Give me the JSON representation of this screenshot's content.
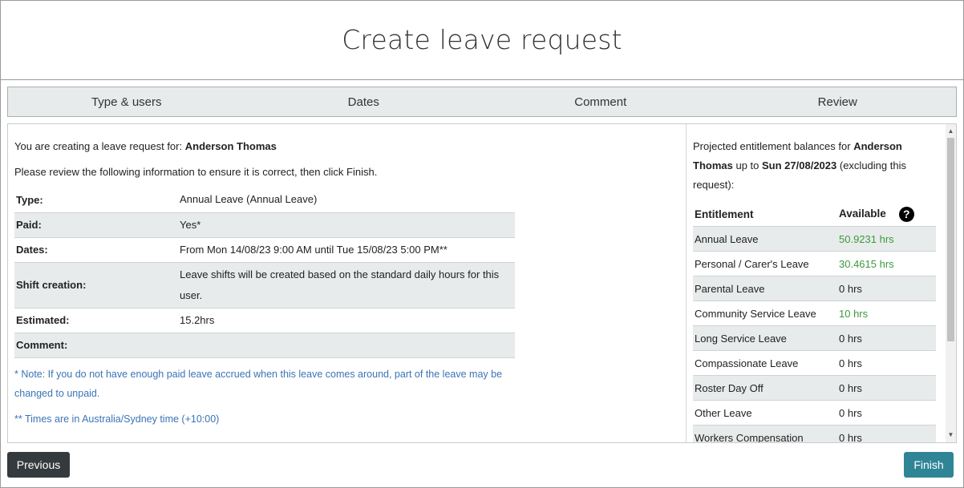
{
  "page": {
    "title": "Create leave request"
  },
  "steps": [
    "Type & users",
    "Dates",
    "Comment",
    "Review"
  ],
  "summary": {
    "intro_prefix": "You are creating a leave request for:",
    "user_name": "Anderson Thomas",
    "instruction": "Please review the following information to ensure it is correct, then click Finish.",
    "rows": [
      {
        "label": "Type:",
        "value": "Annual Leave (Annual Leave)"
      },
      {
        "label": "Paid:",
        "value": "Yes*"
      },
      {
        "label": "Dates:",
        "value": "From Mon 14/08/23 9:00 AM until Tue 15/08/23 5:00 PM**"
      },
      {
        "label": "Shift creation:",
        "value": "Leave shifts will be created based on the standard daily hours for this user."
      },
      {
        "label": "Estimated:",
        "value": "15.2hrs"
      },
      {
        "label": "Comment:",
        "value": ""
      }
    ],
    "note1": "* Note: If you do not have enough paid leave accrued when this leave comes around, part of the leave may be changed to unpaid.",
    "note2": "** Times are in Australia/Sydney time (+10:00)"
  },
  "entitlements": {
    "intro_prefix": "Projected entitlement balances for",
    "user_name": "Anderson Thomas",
    "up_to_text": "up to",
    "date": "Sun 27/08/2023",
    "suffix": "(excluding this request):",
    "header_entitlement": "Entitlement",
    "header_available": "Available",
    "help_icon": "?",
    "rows": [
      {
        "name": "Annual Leave",
        "available": "50.9231 hrs"
      },
      {
        "name": "Personal / Carer's Leave",
        "available": "30.4615 hrs"
      },
      {
        "name": "Parental Leave",
        "available": "0 hrs"
      },
      {
        "name": "Community Service Leave",
        "available": "10 hrs"
      },
      {
        "name": "Long Service Leave",
        "available": "0 hrs"
      },
      {
        "name": "Compassionate Leave",
        "available": "0 hrs"
      },
      {
        "name": "Roster Day Off",
        "available": "0 hrs"
      },
      {
        "name": "Other Leave",
        "available": "0 hrs"
      },
      {
        "name": "Workers Compensation",
        "available": "0 hrs"
      }
    ]
  },
  "buttons": {
    "previous": "Previous",
    "finish": "Finish"
  },
  "colors": {
    "accent": "#2f8596",
    "dark_button": "#343a3d",
    "positive": "#3c9a3c",
    "note": "#3b74b5"
  }
}
